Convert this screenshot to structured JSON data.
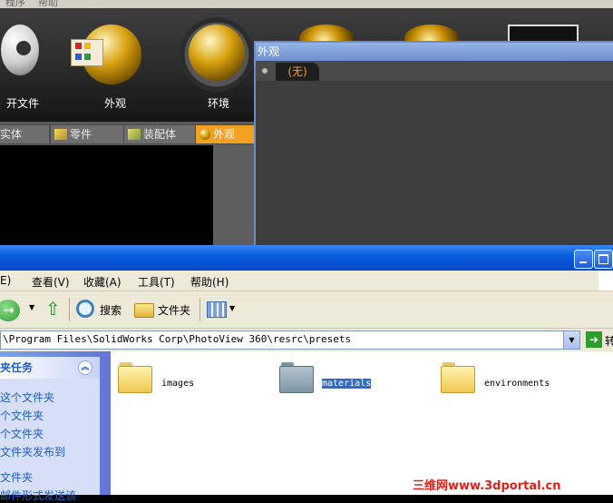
{
  "pv": {
    "menu": [
      "程序",
      "帮助"
    ],
    "tools": [
      {
        "label": "开文件"
      },
      {
        "label": "外观"
      },
      {
        "label": "环境"
      }
    ],
    "tabs": [
      {
        "label": "实体"
      },
      {
        "label": "零件"
      },
      {
        "label": "装配体"
      },
      {
        "label": "外观",
        "active": true
      }
    ]
  },
  "appearance_panel": {
    "title": "外观",
    "tab": "(无)"
  },
  "explorer": {
    "menu": [
      "E)",
      "查看(V)",
      "收藏(A)",
      "工具(T)",
      "帮助(H)"
    ],
    "toolbar": {
      "search": "搜索",
      "folders": "文件夹"
    },
    "address": "\\Program Files\\SolidWorks Corp\\PhotoView 360\\resrc\\presets",
    "go_label": "转",
    "tasks": {
      "title": "夹任务",
      "items": [
        "这个文件夹",
        "个文件夹",
        "个文件夹",
        "文件夹发布到",
        "文件夹",
        "邮件形式发送该"
      ]
    },
    "folders": [
      {
        "name": "images",
        "selected": false
      },
      {
        "name": "materials",
        "selected": true
      },
      {
        "name": "environments",
        "selected": false
      }
    ]
  },
  "watermark": "三维网www.3dportal.cn",
  "colors": {
    "accent_orange": "#f4a020",
    "xp_blue": "#0a5fe0",
    "selection": "#316ac5"
  }
}
